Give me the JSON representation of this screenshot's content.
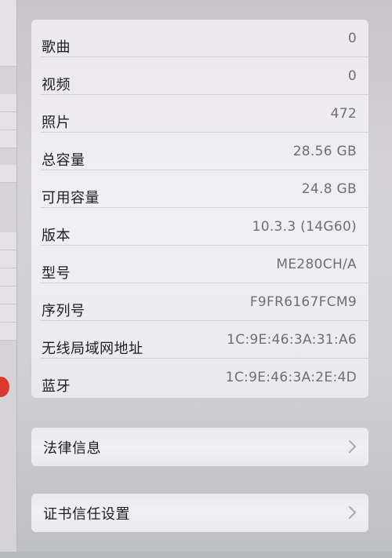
{
  "about": {
    "rows": [
      {
        "label": "歌曲",
        "value": "0"
      },
      {
        "label": "视频",
        "value": "0"
      },
      {
        "label": "照片",
        "value": "472"
      },
      {
        "label": "总容量",
        "value": "28.56 GB"
      },
      {
        "label": "可用容量",
        "value": "24.8 GB"
      },
      {
        "label": "版本",
        "value": "10.3.3 (14G60)"
      },
      {
        "label": "型号",
        "value": "ME280CH/A"
      },
      {
        "label": "序列号",
        "value": "F9FR6167FCM9"
      },
      {
        "label": "无线局域网地址",
        "value": "1C:9E:46:3A:31:A6"
      },
      {
        "label": "蓝牙",
        "value": "1C:9E:46:3A:2E:4D"
      }
    ]
  },
  "nav": {
    "legal_label": "法律信息",
    "cert_label": "证书信任设置",
    "chevron_icon": "chevron-right-icon"
  },
  "colors": {
    "label": "#1e1e22",
    "value": "#6f6e74",
    "badge": "#d83a2e"
  }
}
